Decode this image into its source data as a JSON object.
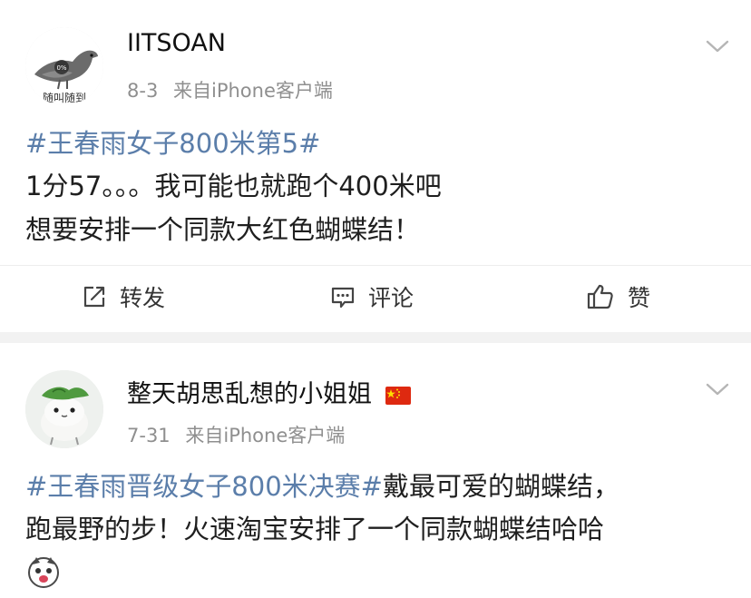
{
  "posts": [
    {
      "username": "IITSOAN",
      "avatar_text": "随叫随到",
      "avatar_badge": "0%",
      "date": "8-3",
      "source": "来自iPhone客户端",
      "hashtag": "#王春雨女子800米第5#",
      "line2": "1分57。。。我可能也就跑个400米吧",
      "line3": "想要安排一个同款大红色蝴蝶结！",
      "actions": {
        "repost": "转发",
        "comment": "评论",
        "like": "赞"
      }
    },
    {
      "username": "整天胡思乱想的小姐姐",
      "date": "7-31",
      "source": "来自iPhone客户端",
      "hashtag": "#王春雨晋级女子800米决赛#",
      "line1_rest": "戴最可爱的蝴蝶结，",
      "line2": "跑最野的步！火速淘宝安排了一个同款蝴蝶结哈哈"
    }
  ],
  "icons": [
    "chevron-down-icon",
    "repost-icon",
    "comment-icon",
    "like-icon",
    "china-flag-icon",
    "emoji-icon"
  ],
  "colors": {
    "hashtag": "#5b7eaa",
    "meta": "#8f8f8f",
    "separator": "#f2f2f2"
  }
}
